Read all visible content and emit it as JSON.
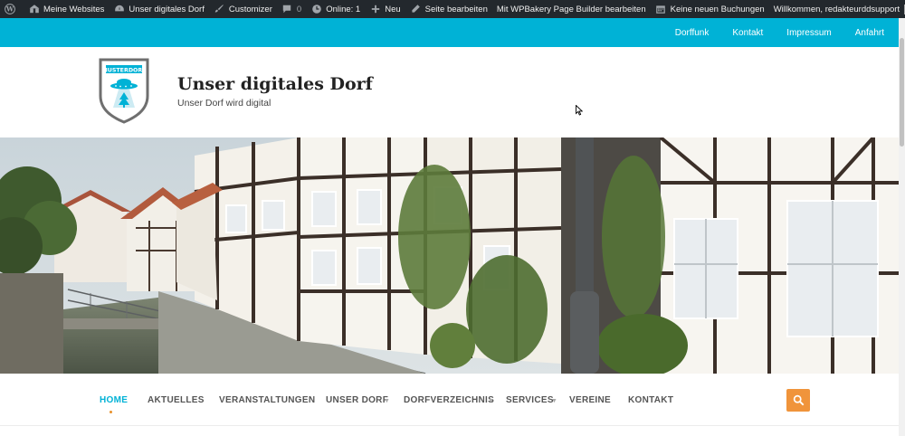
{
  "adminbar": {
    "items": [
      {
        "label": "",
        "icon": "wordpress-icon"
      },
      {
        "label": "Meine Websites",
        "icon": "my-sites-icon"
      },
      {
        "label": "Unser digitales Dorf",
        "icon": "dashboard-icon"
      },
      {
        "label": "Customizer",
        "icon": "brush-icon"
      },
      {
        "label": "0",
        "icon": "comment-icon"
      },
      {
        "label": "Online: 1",
        "icon": "clock-icon"
      },
      {
        "label": "Neu",
        "icon": "plus-icon"
      },
      {
        "label": "Seite bearbeiten",
        "icon": "pencil-icon"
      },
      {
        "label": "Mit WPBakery Page Builder bearbeiten",
        "icon": ""
      },
      {
        "label": "Keine neuen Buchungen",
        "icon": "calendar-icon"
      }
    ],
    "welcome": "Willkommen, redakteurddsupport",
    "search_icon": "search-icon"
  },
  "topbar": {
    "links": [
      "Dorffunk",
      "Kontakt",
      "Impressum",
      "Anfahrt"
    ],
    "color": "#00b2d6"
  },
  "header": {
    "logo_text": "MUSTERDORF",
    "title": "Unser digitales Dorf",
    "tagline": "Unser Dorf wird digital"
  },
  "nav": {
    "items": [
      {
        "label": "HOME",
        "active": true
      },
      {
        "label": "AKTUELLES"
      },
      {
        "label": "VERANSTALTUNGEN"
      },
      {
        "label": "UNSER DORF",
        "submenu": true
      },
      {
        "label": "DORFVERZEICHNIS",
        "submenu": true
      },
      {
        "label": "SERVICES",
        "submenu": true
      },
      {
        "label": "VEREINE"
      },
      {
        "label": "KONTAKT"
      }
    ],
    "search_color": "#f0943b"
  }
}
